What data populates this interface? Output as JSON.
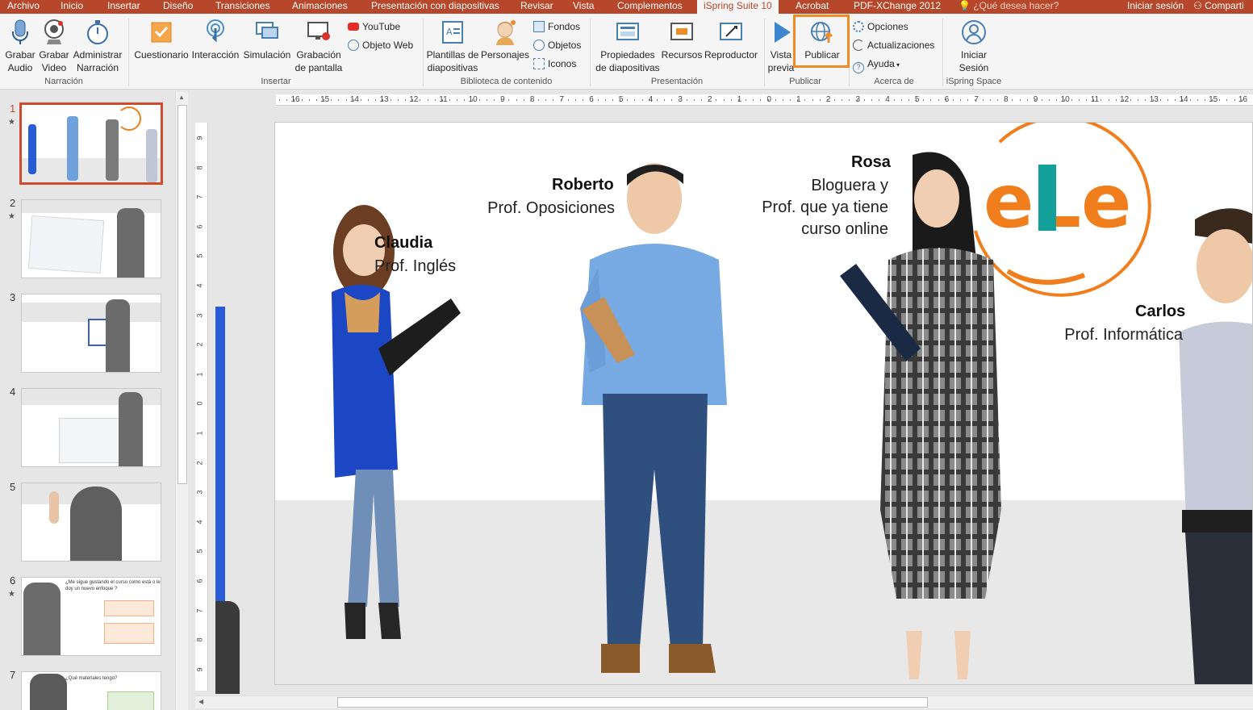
{
  "tabs": [
    "Archivo",
    "Inicio",
    "Insertar",
    "Diseño",
    "Transiciones",
    "Animaciones",
    "Presentación con diapositivas",
    "Revisar",
    "Vista",
    "Complementos",
    "iSpring Suite 10",
    "Acrobat",
    "PDF-XChange 2012"
  ],
  "tell_me": "¿Qué desea hacer?",
  "sign_in": "Iniciar sesión",
  "share": "Comparti",
  "ribbon": {
    "narracion": {
      "grabar_audio": "Grabar\nAudio",
      "grabar_video": "Grabar\nVideo",
      "administrar": "Administrar\nNarración",
      "label": "Narración"
    },
    "insertar": {
      "cuestionario": "Cuestionario",
      "interaccion": "Interacción",
      "simulacion": "Simulación",
      "grabacion": "Grabación\nde pantalla",
      "youtube": "YouTube",
      "objeto_web": "Objeto Web",
      "label": "Insertar"
    },
    "biblioteca": {
      "plantillas": "Plantillas de\ndiapositivas",
      "personajes": "Personajes",
      "fondos": "Fondos",
      "objetos": "Objetos",
      "iconos": "Iconos",
      "label": "Biblioteca de contenido"
    },
    "presentacion": {
      "propiedades": "Propiedades\nde diapositivas",
      "recursos": "Recursos",
      "reproductor": "Reproductor",
      "label": "Presentación"
    },
    "publicar": {
      "vista_previa": "Vista\nprevia",
      "publicar": "Publicar",
      "label": "Publicar"
    },
    "acerca": {
      "opciones": "Opciones",
      "actualizaciones": "Actualizaciones",
      "ayuda": "Ayuda",
      "label": "Acerca de"
    },
    "ispring_space": {
      "iniciar": "Iniciar\nSesión",
      "label": "iSpring Space"
    }
  },
  "thumbnails": [
    {
      "num": "1",
      "star": true
    },
    {
      "num": "2",
      "star": true
    },
    {
      "num": "3",
      "star": false
    },
    {
      "num": "4",
      "star": false
    },
    {
      "num": "5",
      "star": false
    },
    {
      "num": "6",
      "star": true,
      "text": "¿Me sigue gustando el curso como está o le doy un nuevo enfoque ?"
    },
    {
      "num": "7",
      "star": false,
      "text": "¿Qué materiales tengo?"
    }
  ],
  "ruler_h": [
    "16",
    "15",
    "14",
    "13",
    "12",
    "11",
    "10",
    "9",
    "8",
    "7",
    "6",
    "5",
    "4",
    "3",
    "2",
    "1",
    "0",
    "1",
    "2",
    "3",
    "4",
    "5",
    "6",
    "7",
    "8",
    "9",
    "10",
    "11",
    "12",
    "13",
    "14",
    "15",
    "16"
  ],
  "ruler_v": [
    "9",
    "8",
    "7",
    "6",
    "5",
    "4",
    "3",
    "2",
    "1",
    "0",
    "1",
    "2",
    "3",
    "4",
    "5",
    "6",
    "7",
    "8",
    "9"
  ],
  "slide": {
    "logo_text": "eLe",
    "people": [
      {
        "name": "Claudia",
        "role": "Prof. Inglés"
      },
      {
        "name": "Roberto",
        "role": "Prof. Oposiciones"
      },
      {
        "name": "Rosa",
        "role": "Bloguera y\nProf. que ya tiene\ncurso online"
      },
      {
        "name": "Carlos",
        "role": "Prof. Informática"
      }
    ]
  },
  "colors": {
    "accent": "#b7472a",
    "highlight": "#f08c28",
    "logo_orange": "#f07e1c",
    "logo_teal": "#14a09a"
  }
}
